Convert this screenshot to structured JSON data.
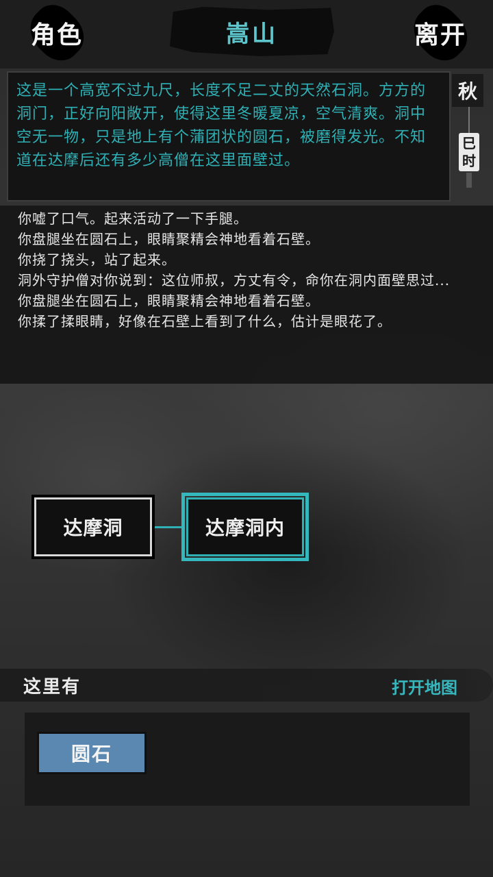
{
  "header": {
    "left_button": "角色",
    "title": "嵩山",
    "right_button": "离开"
  },
  "description": "这是一个高宽不过九尺，长度不足二丈的天然石洞。方方的洞门，正好向阳敞开，使得这里冬暖夏凉，空气清爽。洞中空无一物，只是地上有个蒲团状的圆石，被磨得发光。不知道在达摩后还有多少高僧在这里面壁过。",
  "time": {
    "season": "秋",
    "hour": "巳时"
  },
  "log": [
    "你嘘了口气。起来活动了一下手腿。",
    "你盘腿坐在圆石上，眼睛聚精会神地看着石壁。",
    "你挠了挠头，站了起来。",
    "洞外守护僧对你说到：这位师叔，方丈有令，命你在洞内面壁思过...",
    "你盘腿坐在圆石上，眼睛聚精会神地看着石壁。",
    "你揉了揉眼睛，好像在石壁上看到了什么，估计是眼花了。"
  ],
  "map": {
    "nodes": [
      {
        "label": "达摩洞",
        "current": false
      },
      {
        "label": "达摩洞内",
        "current": true
      }
    ]
  },
  "here": {
    "label": "这里有",
    "open_map": "打开地图",
    "items": [
      "圆石"
    ]
  },
  "colors": {
    "accent": "#2fb0b4",
    "item_button": "#5a88b0"
  }
}
